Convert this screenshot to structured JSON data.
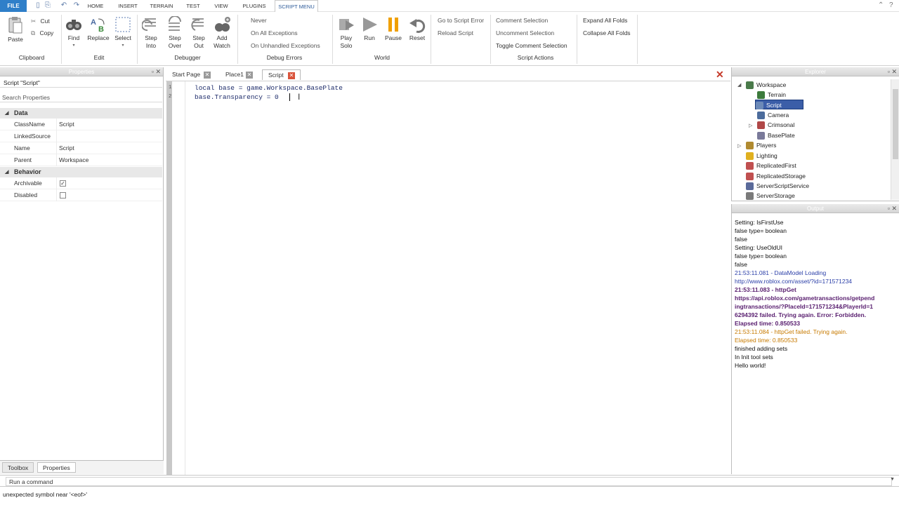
{
  "menubar": {
    "file": "FILE",
    "tabs": [
      "HOME",
      "INSERT",
      "TERRAIN",
      "TEST",
      "VIEW",
      "PLUGINS",
      "SCRIPT MENU"
    ]
  },
  "ribbon": {
    "clipboard": {
      "paste": "Paste",
      "cut": "Cut",
      "copy": "Copy",
      "label": "Clipboard"
    },
    "edit": {
      "find": "Find",
      "replace": "Replace",
      "select": "Select",
      "label": "Edit"
    },
    "debugger": {
      "step_into": [
        "Step",
        "Into"
      ],
      "step_over": [
        "Step",
        "Over"
      ],
      "step_out": [
        "Step",
        "Out"
      ],
      "add_watch": [
        "Add",
        "Watch"
      ],
      "label": "Debugger"
    },
    "debug_errors": {
      "options": [
        "Never",
        "On All Exceptions",
        "On Unhandled Exceptions"
      ],
      "label": "Debug Errors"
    },
    "world": {
      "play_solo": [
        "Play",
        "Solo"
      ],
      "run": "Run",
      "pause": "Pause",
      "reset": "Reset",
      "label": "World"
    },
    "script_errors": {
      "go_to": "Go to Script Error",
      "reload": "Reload Script"
    },
    "script_actions": {
      "comment": "Comment Selection",
      "uncomment": "Uncomment Selection",
      "toggle": "Toggle Comment Selection",
      "label": "Script Actions"
    },
    "folds": {
      "expand": "Expand All Folds",
      "collapse": "Collapse All Folds"
    }
  },
  "properties": {
    "title": "Properties",
    "header": "Script \"Script\"",
    "search_placeholder": "Search Properties",
    "sections": {
      "data": "Data",
      "behavior": "Behavior"
    },
    "rows": [
      {
        "key": "ClassName",
        "value": "Script"
      },
      {
        "key": "LinkedSource",
        "value": ""
      },
      {
        "key": "Name",
        "value": "Script"
      },
      {
        "key": "Parent",
        "value": "Workspace"
      }
    ],
    "behavior_rows": [
      {
        "key": "Archivable",
        "checked": true
      },
      {
        "key": "Disabled",
        "checked": false
      }
    ],
    "bottom_tabs": [
      "Toolbox",
      "Properties"
    ]
  },
  "editor": {
    "tabs": [
      "Start Page",
      "Place1",
      "Script"
    ],
    "line_numbers": [
      "1",
      "2"
    ],
    "lines": [
      "local base = game.Workspace.BasePlate",
      "base.Transparency = 0"
    ]
  },
  "explorer": {
    "title": "Explorer",
    "items": [
      {
        "label": "Workspace",
        "color": "#4a7a4a"
      },
      {
        "label": "Terrain",
        "color": "#3c7a3c"
      },
      {
        "label": "Script",
        "color": "#6c8ab8"
      },
      {
        "label": "Camera",
        "color": "#4c6c9c"
      },
      {
        "label": "Crimsonal",
        "color": "#b04848"
      },
      {
        "label": "BasePlate",
        "color": "#7a7a9a"
      },
      {
        "label": "Players",
        "color": "#b08a30"
      },
      {
        "label": "Lighting",
        "color": "#e0b020"
      },
      {
        "label": "ReplicatedFirst",
        "color": "#c05050"
      },
      {
        "label": "ReplicatedStorage",
        "color": "#c05050"
      },
      {
        "label": "ServerScriptService",
        "color": "#5a6a9a"
      },
      {
        "label": "ServerStorage",
        "color": "#7a7a7a"
      }
    ]
  },
  "output": {
    "title": "Output",
    "lines": [
      {
        "text": "Setting: IsFirstUse",
        "style": "black"
      },
      {
        "text": "false type= boolean",
        "style": "black"
      },
      {
        "text": "false",
        "style": "black"
      },
      {
        "text": "Setting: UseOldUI",
        "style": "black"
      },
      {
        "text": "false type= boolean",
        "style": "black"
      },
      {
        "text": "false",
        "style": "black"
      },
      {
        "text": "21:53:11.081 - DataModel Loading",
        "style": "blue"
      },
      {
        "text": "http://www.roblox.com/asset/?id=171571234",
        "style": "blue"
      },
      {
        "text": "21:53:11.083 - httpGet",
        "style": "purple"
      },
      {
        "text": "https://api.roblox.com/gametransactions/getpend",
        "style": "purple"
      },
      {
        "text": "ingtransactions/?PlaceId=171571234&PlayerId=1",
        "style": "purple"
      },
      {
        "text": "6294392 failed. Trying again. Error: Forbidden.",
        "style": "purple"
      },
      {
        "text": "Elapsed time: 0.850533",
        "style": "purple"
      },
      {
        "text": "21:53:11.084 - httpGet failed. Trying again.",
        "style": "orange"
      },
      {
        "text": "Elapsed time: 0.850533",
        "style": "orange"
      },
      {
        "text": "finished adding sets",
        "style": "black"
      },
      {
        "text": "In Init tool sets",
        "style": "black"
      },
      {
        "text": "Hello world!",
        "style": "black"
      }
    ]
  },
  "command": {
    "placeholder": "Run a command"
  },
  "status": "unexpected symbol near '<eof>'"
}
